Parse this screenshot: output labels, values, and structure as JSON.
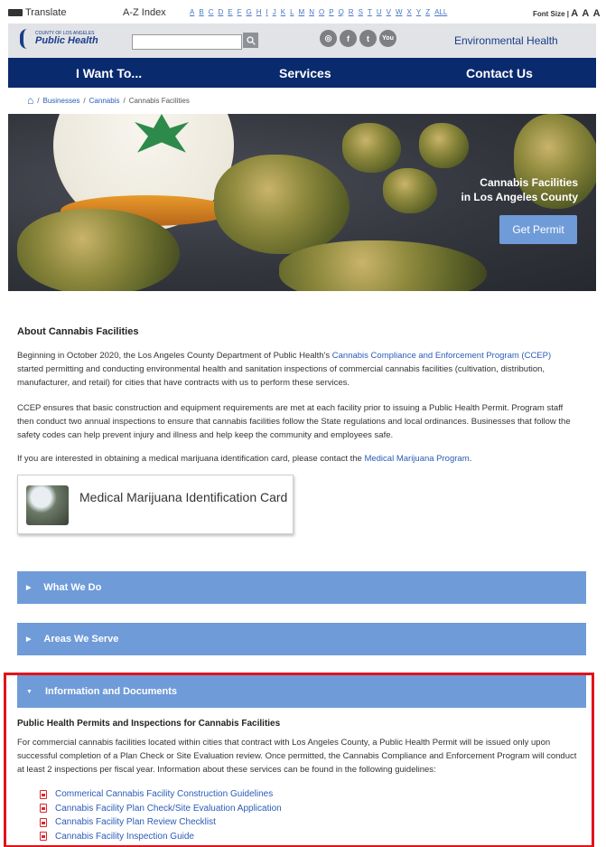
{
  "utility": {
    "translate_label": "Translate",
    "az_label": "A-Z Index",
    "letters": [
      "A",
      "B",
      "C",
      "D",
      "E",
      "F",
      "G",
      "H",
      "I",
      "J",
      "K",
      "L",
      "M",
      "N",
      "O",
      "P",
      "Q",
      "R",
      "S",
      "T",
      "U",
      "V",
      "W",
      "X",
      "Y",
      "Z",
      "ALL"
    ],
    "font_size_label": "Font Size |",
    "font_size_options": "A A A"
  },
  "header": {
    "logo_small": "COUNTY OF LOS ANGELES",
    "logo_name": "Public Health",
    "search_placeholder": "",
    "search_icon": "search-icon",
    "social": [
      {
        "name": "instagram-icon",
        "glyph": "◎"
      },
      {
        "name": "facebook-icon",
        "glyph": "f"
      },
      {
        "name": "twitter-icon",
        "glyph": "t"
      },
      {
        "name": "youtube-icon",
        "glyph": "You"
      }
    ],
    "env_link": "Environmental Health"
  },
  "nav": {
    "items": [
      "I Want To...",
      "Services",
      "Contact Us"
    ]
  },
  "breadcrumb": {
    "home_icon": "home-icon",
    "items": [
      "Businesses",
      "Cannabis",
      "Cannabis Facilities"
    ]
  },
  "hero": {
    "title_line1": "Cannabis Facilities",
    "title_line2": "in Los Angeles County",
    "button": "Get Permit"
  },
  "about": {
    "title": "About Cannabis Facilities",
    "p1_a": "Beginning in October 2020, the Los Angeles County Department of Public Health's ",
    "p1_link": "Cannabis Compliance and Enforcement Program (CCEP)",
    "p1_b": " started permitting and conducting environmental health and sanitation inspections of commercial cannabis facilities (cultivation, distribution, manufacturer, and retail) for cities that have contracts with us to perform these services.",
    "p2": "CCEP ensures that basic construction and equipment requirements are met at each facility prior to issuing a Public Health Permit. Program staff then conduct two annual inspections to ensure that cannabis facilities follow the State regulations and local ordinances. Businesses that follow the safety codes can help prevent injury and illness and help keep the community and employees safe.",
    "p3_a": "If you are interested in obtaining a medical marijuana identification card, please contact the ",
    "p3_link": "Medical Marijuana Program",
    "p3_b": "."
  },
  "card": {
    "label": "Medical Marijuana Identification Card"
  },
  "accordion": [
    {
      "label": "What We Do",
      "state": "collapsed"
    },
    {
      "label": "Areas We Serve",
      "state": "collapsed"
    },
    {
      "label": "Information and Documents",
      "state": "expanded"
    }
  ],
  "documents": {
    "title": "Public Health Permits and Inspections for Cannabis Facilities",
    "body": "For commercial cannabis facilities located within cities that contract with Los Angeles County, a Public Health Permit will be issued only upon successful completion of a Plan Check or Site Evaluation review. Once permitted, the Cannabis Compliance and Enforcement Program will conduct at least 2 inspections per fiscal year. Information about these services can be found in the following guidelines:",
    "links": [
      "Commerical Cannabis Facility Construction Guidelines",
      "Cannabis Facility Plan Check/Site Evaluation Application",
      "Cannabis Facility Plan Review Checklist",
      "Cannabis Facility Inspection Guide"
    ]
  },
  "colors": {
    "nav_bg": "#0a2a6e",
    "accordion_bg": "#6f9bd8",
    "link": "#2a5bb8",
    "highlight_border": "#e3121b"
  }
}
